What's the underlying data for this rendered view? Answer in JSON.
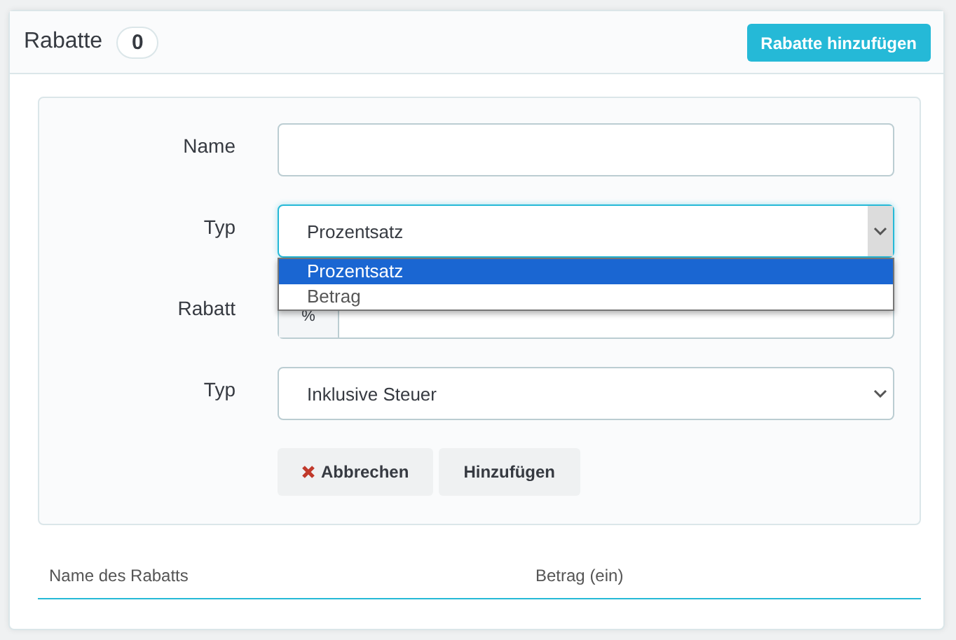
{
  "header": {
    "title": "Rabatte",
    "count": "0",
    "add_button": "Rabatte hinzufügen"
  },
  "form": {
    "fields": [
      {
        "kind": "text",
        "label": "Name"
      },
      {
        "kind": "select",
        "label": "Typ",
        "value": "Prozentsatz",
        "expanded": true,
        "options": [
          {
            "label": "Prozentsatz",
            "selected": true
          },
          {
            "label": "Betrag",
            "selected": false
          }
        ]
      },
      {
        "kind": "addon",
        "label": "Rabatt",
        "addon": "%"
      },
      {
        "kind": "select",
        "label": "Typ",
        "value": "Inklusive Steuer",
        "expanded": false
      }
    ],
    "buttons": [
      {
        "kind": "cancel",
        "label": "Abbrechen"
      },
      {
        "kind": "submit",
        "label": "Hinzufügen"
      }
    ]
  },
  "table": {
    "columns": [
      "Name des Rabatts",
      "Betrag (ein)"
    ]
  }
}
